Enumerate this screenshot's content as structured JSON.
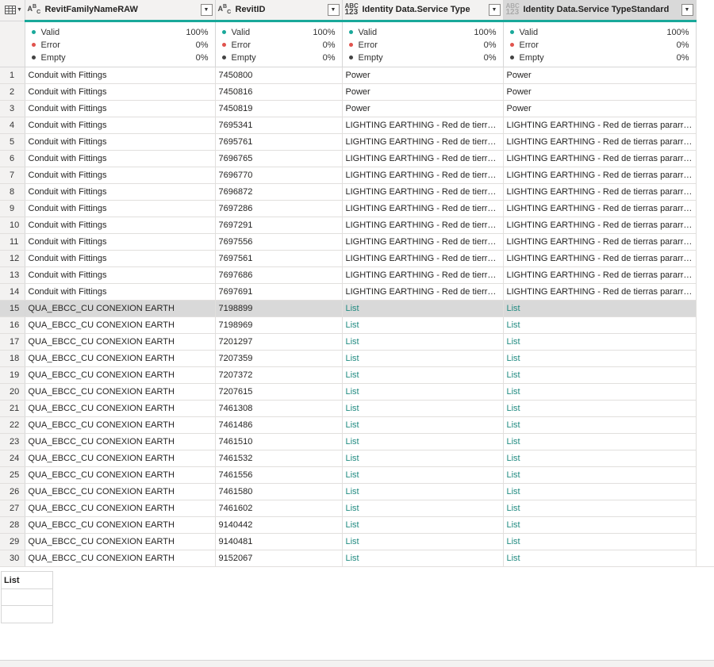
{
  "columns": [
    {
      "name": "RevitFamilyNameRAW",
      "type_icon": "text-type-icon",
      "type_glyph": "Aᴮᶜ"
    },
    {
      "name": "RevitID",
      "type_icon": "text-type-icon"
    },
    {
      "name": "Identity Data.Service Type",
      "type_icon": "any-type-icon"
    },
    {
      "name": "Identity Data.Service TypeStandard",
      "type_icon": "any-type-icon"
    }
  ],
  "profile": {
    "labels": {
      "valid": "Valid",
      "error": "Error",
      "empty": "Empty"
    },
    "columns": [
      {
        "valid": "100%",
        "error": "0%",
        "empty": "0%"
      },
      {
        "valid": "100%",
        "error": "0%",
        "empty": "0%"
      },
      {
        "valid": "100%",
        "error": "0%",
        "empty": "0%"
      },
      {
        "valid": "100%",
        "error": "0%",
        "empty": "0%"
      }
    ]
  },
  "rows": [
    {
      "idx": "1",
      "family": "Conduit with Fittings",
      "id": "7450800",
      "service": "Power",
      "standard": "Power"
    },
    {
      "idx": "2",
      "family": "Conduit with Fittings",
      "id": "7450816",
      "service": "Power",
      "standard": "Power"
    },
    {
      "idx": "3",
      "family": "Conduit with Fittings",
      "id": "7450819",
      "service": "Power",
      "standard": "Power"
    },
    {
      "idx": "4",
      "family": "Conduit with Fittings",
      "id": "7695341",
      "service": "LIGHTING EARTHING - Red de tierras p...",
      "standard": "LIGHTING EARTHING - Red de tierras pararrayos"
    },
    {
      "idx": "5",
      "family": "Conduit with Fittings",
      "id": "7695761",
      "service": "LIGHTING EARTHING - Red de tierras p...",
      "standard": "LIGHTING EARTHING - Red de tierras pararrayos"
    },
    {
      "idx": "6",
      "family": "Conduit with Fittings",
      "id": "7696765",
      "service": "LIGHTING EARTHING - Red de tierras p...",
      "standard": "LIGHTING EARTHING - Red de tierras pararrayos"
    },
    {
      "idx": "7",
      "family": "Conduit with Fittings",
      "id": "7696770",
      "service": "LIGHTING EARTHING - Red de tierras p...",
      "standard": "LIGHTING EARTHING - Red de tierras pararrayos"
    },
    {
      "idx": "8",
      "family": "Conduit with Fittings",
      "id": "7696872",
      "service": "LIGHTING EARTHING - Red de tierras p...",
      "standard": "LIGHTING EARTHING - Red de tierras pararrayos"
    },
    {
      "idx": "9",
      "family": "Conduit with Fittings",
      "id": "7697286",
      "service": "LIGHTING EARTHING - Red de tierras p...",
      "standard": "LIGHTING EARTHING - Red de tierras pararrayos"
    },
    {
      "idx": "10",
      "family": "Conduit with Fittings",
      "id": "7697291",
      "service": "LIGHTING EARTHING - Red de tierras p...",
      "standard": "LIGHTING EARTHING - Red de tierras pararrayos"
    },
    {
      "idx": "11",
      "family": "Conduit with Fittings",
      "id": "7697556",
      "service": "LIGHTING EARTHING - Red de tierras p...",
      "standard": "LIGHTING EARTHING - Red de tierras pararrayos"
    },
    {
      "idx": "12",
      "family": "Conduit with Fittings",
      "id": "7697561",
      "service": "LIGHTING EARTHING - Red de tierras p...",
      "standard": "LIGHTING EARTHING - Red de tierras pararrayos"
    },
    {
      "idx": "13",
      "family": "Conduit with Fittings",
      "id": "7697686",
      "service": "LIGHTING EARTHING - Red de tierras p...",
      "standard": "LIGHTING EARTHING - Red de tierras pararrayos"
    },
    {
      "idx": "14",
      "family": "Conduit with Fittings",
      "id": "7697691",
      "service": "LIGHTING EARTHING - Red de tierras p...",
      "standard": "LIGHTING EARTHING - Red de tierras pararrayos"
    },
    {
      "idx": "15",
      "family": "QUA_EBCC_CU CONEXION EARTH",
      "id": "7198899",
      "service": "List",
      "standard": "List",
      "selected": true
    },
    {
      "idx": "16",
      "family": "QUA_EBCC_CU CONEXION EARTH",
      "id": "7198969",
      "service": "List",
      "standard": "List"
    },
    {
      "idx": "17",
      "family": "QUA_EBCC_CU CONEXION EARTH",
      "id": "7201297",
      "service": "List",
      "standard": "List"
    },
    {
      "idx": "18",
      "family": "QUA_EBCC_CU CONEXION EARTH",
      "id": "7207359",
      "service": "List",
      "standard": "List"
    },
    {
      "idx": "19",
      "family": "QUA_EBCC_CU CONEXION EARTH",
      "id": "7207372",
      "service": "List",
      "standard": "List"
    },
    {
      "idx": "20",
      "family": "QUA_EBCC_CU CONEXION EARTH",
      "id": "7207615",
      "service": "List",
      "standard": "List"
    },
    {
      "idx": "21",
      "family": "QUA_EBCC_CU CONEXION EARTH",
      "id": "7461308",
      "service": "List",
      "standard": "List"
    },
    {
      "idx": "22",
      "family": "QUA_EBCC_CU CONEXION EARTH",
      "id": "7461486",
      "service": "List",
      "standard": "List"
    },
    {
      "idx": "23",
      "family": "QUA_EBCC_CU CONEXION EARTH",
      "id": "7461510",
      "service": "List",
      "standard": "List"
    },
    {
      "idx": "24",
      "family": "QUA_EBCC_CU CONEXION EARTH",
      "id": "7461532",
      "service": "List",
      "standard": "List"
    },
    {
      "idx": "25",
      "family": "QUA_EBCC_CU CONEXION EARTH",
      "id": "7461556",
      "service": "List",
      "standard": "List"
    },
    {
      "idx": "26",
      "family": "QUA_EBCC_CU CONEXION EARTH",
      "id": "7461580",
      "service": "List",
      "standard": "List"
    },
    {
      "idx": "27",
      "family": "QUA_EBCC_CU CONEXION EARTH",
      "id": "7461602",
      "service": "List",
      "standard": "List"
    },
    {
      "idx": "28",
      "family": "QUA_EBCC_CU CONEXION EARTH",
      "id": "9140442",
      "service": "List",
      "standard": "List"
    },
    {
      "idx": "29",
      "family": "QUA_EBCC_CU CONEXION EARTH",
      "id": "9140481",
      "service": "List",
      "standard": "List"
    },
    {
      "idx": "30",
      "family": "QUA_EBCC_CU CONEXION EARTH",
      "id": "9152067",
      "service": "List",
      "standard": "List"
    }
  ],
  "preview": {
    "header": "List"
  },
  "colors": {
    "accent": "#19a89a",
    "link": "#1f8a80",
    "selected": "#d9d9d9",
    "error": "#e0534d"
  }
}
